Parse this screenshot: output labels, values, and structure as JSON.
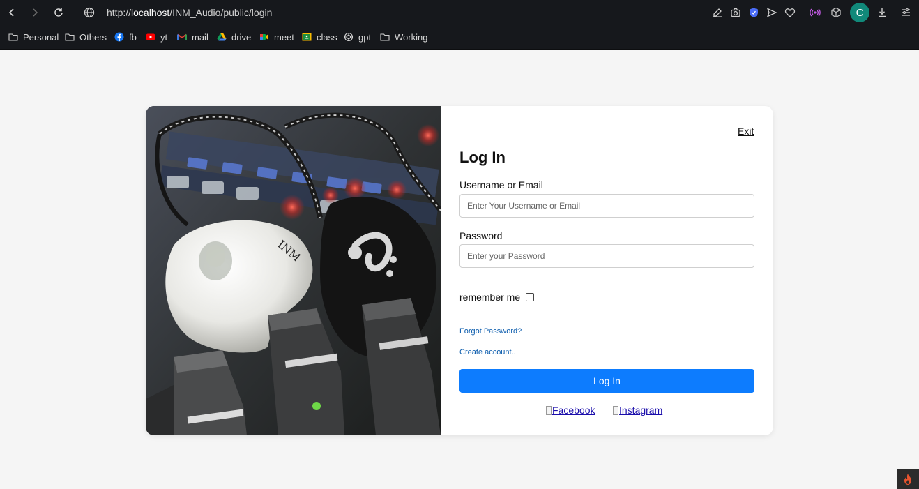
{
  "browser": {
    "url_prefix": "http://",
    "url_host": "localhost",
    "url_path": "/INM_Audio/public/login",
    "profile_initial": "C",
    "toolbar_icons": [
      "edit-icon",
      "camera-icon",
      "shield-icon",
      "send-icon",
      "heart-icon",
      "broadcast-icon",
      "cube-icon",
      "download-icon",
      "menu-icon"
    ]
  },
  "bookmarks": [
    {
      "label": "Personal",
      "icon": "folder-icon"
    },
    {
      "label": "Others",
      "icon": "folder-icon"
    },
    {
      "label": "fb",
      "icon": "facebook-icon"
    },
    {
      "label": "yt",
      "icon": "youtube-icon"
    },
    {
      "label": "mail",
      "icon": "gmail-icon"
    },
    {
      "label": "drive",
      "icon": "drive-icon"
    },
    {
      "label": "meet",
      "icon": "meet-icon"
    },
    {
      "label": "class",
      "icon": "classroom-icon"
    },
    {
      "label": "gpt",
      "icon": "chatgpt-icon"
    },
    {
      "label": "Working",
      "icon": "folder-icon"
    }
  ],
  "login": {
    "exit": "Exit",
    "title": "Log In",
    "username_label": "Username or Email",
    "username_placeholder": "Enter Your Username or Email",
    "password_label": "Password",
    "password_placeholder": "Enter your Password",
    "remember": "remember me",
    "forgot": "Forgot Password?",
    "create": "Create account..",
    "button": "Log In",
    "facebook": "Facebook",
    "instagram": "Instagram"
  },
  "colors": {
    "accent": "#0d7cfe",
    "chrome_bg": "#16181c",
    "page_bg": "#f5f5f5",
    "profile": "#11897a"
  }
}
